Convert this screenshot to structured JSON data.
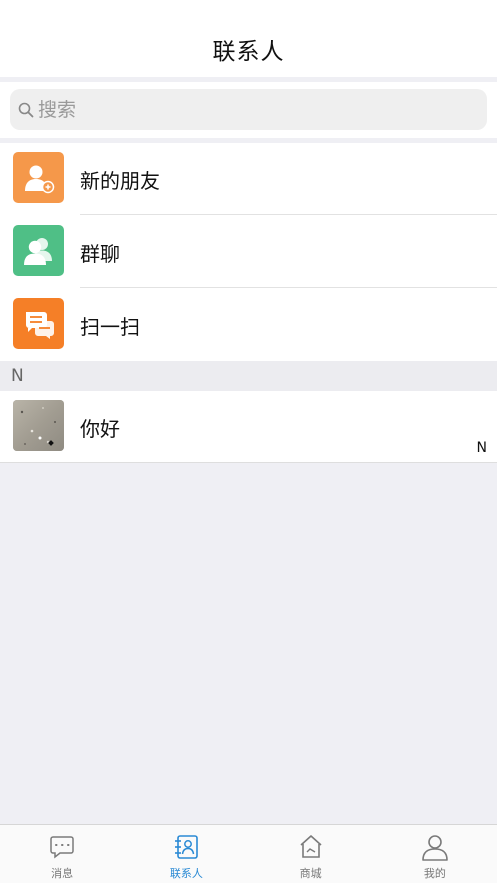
{
  "header": {
    "title": "联系人"
  },
  "search": {
    "placeholder": "搜索",
    "icon": "search-icon"
  },
  "menu": {
    "items": [
      {
        "label": "新的朋友",
        "icon": "add-friend-icon",
        "color": "#f5984a"
      },
      {
        "label": "群聊",
        "icon": "group-chat-icon",
        "color": "#4fbf86"
      },
      {
        "label": "扫一扫",
        "icon": "scan-icon",
        "color": "#f57f27"
      }
    ]
  },
  "contacts": {
    "section_letter": "N",
    "items": [
      {
        "name": "你好",
        "avatar": "photo-avatar"
      }
    ],
    "index_letter": "N"
  },
  "tabbar": {
    "accent": "#2a8ad4",
    "tabs": [
      {
        "label": "消息",
        "icon": "message-icon",
        "active": false
      },
      {
        "label": "联系人",
        "icon": "contacts-icon",
        "active": true
      },
      {
        "label": "商城",
        "icon": "store-icon",
        "active": false
      },
      {
        "label": "我的",
        "icon": "profile-icon",
        "active": false
      }
    ]
  }
}
